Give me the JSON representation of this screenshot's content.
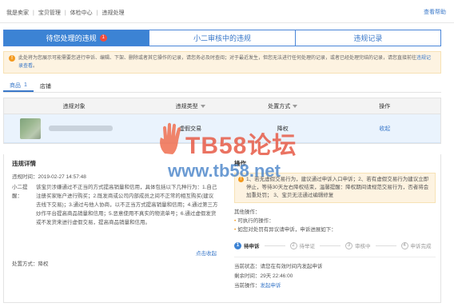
{
  "breadcrumb": [
    "我是卖家",
    "宝贝管理",
    "体检中心",
    "违规处理"
  ],
  "help_link": "查看帮助",
  "tabs": [
    {
      "label": "待您处理的违规",
      "badge": "1",
      "active": true
    },
    {
      "label": "小二审核中的违规",
      "active": false
    },
    {
      "label": "违规记录",
      "active": false
    }
  ],
  "notice": {
    "text": "此处将为您展示可能需要您进行申诉、编辑、下架、删除或者其它操作的记录，请您务必及时查阅；对于最近发生，但您无法进行任何处理的记录，或者已经处理完结的记录，请您直接前往",
    "link": "违规记录查看",
    "tail": "。"
  },
  "subtabs": [
    {
      "label": "商品",
      "count": "1",
      "active": true
    },
    {
      "label": "店铺",
      "active": false
    }
  ],
  "table": {
    "headers": [
      "违规对象",
      "违规类型",
      "处置方式",
      "操作"
    ],
    "row": {
      "type": "虚假交易",
      "action": "降权",
      "op": "收起"
    }
  },
  "detail": {
    "title": "违规详情",
    "time_label": "违规时间：",
    "time_value": "2019-02-27 14:57:48",
    "reason_label": "小二提醒：",
    "reason_value": "该宝贝涉嫌通过不正当的方式提高销量和信用，具体包括以下几种行为：1.自己注册买家账户进行购买；2.既发商或公司内部成员之间不正常的相互购买(建议去线下交易)；3.通过与他人协商，以不正当方式提高销量和信用；4.通过第三方炒作平台提高商品销量和信用；5.恶意使用不真实的物流单号；6.通过虚假发货或不发货来进行虚假交易，提高商品销量和信用。",
    "fold": "点击收起",
    "punish_label": "处置方式：",
    "punish_value": "降权"
  },
  "operation": {
    "title": "操作",
    "box": "1、若无虚假交易行为，建议通过申诉入口申诉；2、若有虚假交易行为建议立即停止，等待30天左右降权结束，温馨提醒：降权期间请规范交易行为，否者将会加重处罚； 3、宝贝无法通过编辑修复",
    "other_title": "其他操作：",
    "other_items": [
      "可执行的操作：",
      "如您对处罚有异议请申诉，申诉进展如下："
    ],
    "steps": [
      {
        "num": "1",
        "label": "待申诉",
        "active": true
      },
      {
        "num": "2",
        "label": "待举证",
        "active": false
      },
      {
        "num": "3",
        "label": "审核中",
        "active": false
      },
      {
        "num": "4",
        "label": "申诉完成",
        "active": false
      }
    ],
    "status": {
      "state_label": "当前状态：",
      "state_value": "请您在有效时间内发起申诉",
      "remain_label": "剩余时间：",
      "remain_value": "29天 22:46:00",
      "op_label": "当前操作：",
      "op_link": "发起申诉"
    }
  },
  "watermark": {
    "title": "TB58论坛",
    "url": "www.tb58.net"
  },
  "colors": {
    "accent": "#3c83d4",
    "warning": "#f39a1e",
    "badge": "#f24c3d",
    "link": "#3a78c9"
  }
}
